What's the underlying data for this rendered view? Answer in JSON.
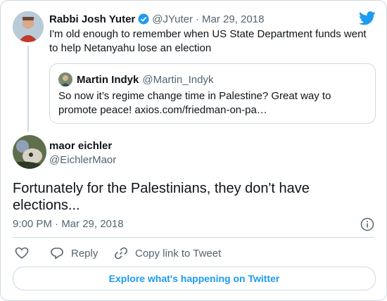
{
  "parent_tweet": {
    "author_name": "Rabbi Josh Yuter",
    "author_handle": "@JYuter",
    "separator": "·",
    "date": "Mar 29, 2018",
    "text_line1": "I'm old enough to remember when US State Department funds went",
    "text_line2": "to help Netanyahu lose an election"
  },
  "quoted_tweet": {
    "author_name": "Martin Indyk",
    "author_handle": "@Martin_Indyk",
    "text_line1": "So now it’s regime change time in Palestine? Great way to",
    "text_line2": "promote peace!  axios.com/friedman-on-pa…"
  },
  "main_tweet": {
    "author_name": "maor eichler",
    "author_handle": "@EichlerMaor",
    "text_line1": "Fortunately for the Palestinians, they don't have",
    "text_line2": "elections...",
    "timestamp": "9:00 PM · Mar 29, 2018"
  },
  "actions": {
    "reply_label": "Reply",
    "copy_label": "Copy link to Tweet"
  },
  "explore_button": {
    "label": "Explore what's happening on Twitter"
  },
  "icons": [
    "twitter-bird-icon",
    "verified-badge-icon",
    "info-icon",
    "heart-icon",
    "reply-icon",
    "link-icon"
  ],
  "colors": {
    "accent": "#1d9bf0",
    "text": "#0f1419",
    "muted": "#536471",
    "border": "#cfd9de"
  }
}
